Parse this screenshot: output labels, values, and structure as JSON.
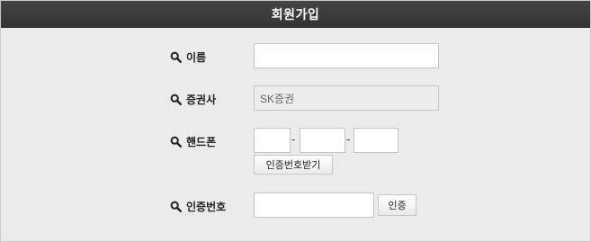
{
  "title": "회원가입",
  "form": {
    "name": {
      "label": "이름",
      "value": ""
    },
    "broker": {
      "label": "증권사",
      "value": "SK증권"
    },
    "phone": {
      "label": "핸드폰",
      "part1": "",
      "part2": "",
      "part3": "",
      "separator": "-",
      "get_code_button": "인증번호받기"
    },
    "code": {
      "label": "인증번호",
      "value": "",
      "verify_button": "인증"
    }
  },
  "icons": {
    "row_icon": "search-icon"
  },
  "colors": {
    "titlebar": "#3a3a3a",
    "panel": "#ebebeb",
    "field_border": "#c4c4c4"
  }
}
